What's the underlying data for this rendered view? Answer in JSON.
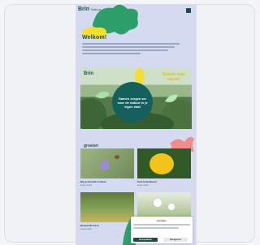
{
  "header": {
    "logo": "Brin",
    "logo_sub": "Natuur"
  },
  "intro": {
    "kicker": "Welkom!"
  },
  "hero": {
    "logo": "Brin",
    "cta": "Samen voor natuur",
    "badge": "Samen zorgen we voor de natuur in je eigen stad"
  },
  "section": {
    "label": "groeien"
  },
  "tiles": [
    {
      "caption": "Bij op Knautia in bloei",
      "sub": "Lees meer"
    },
    {
      "caption": "Gele boterbloem",
      "sub": "Lees meer"
    },
    {
      "caption": "Bloeiende berm",
      "sub": "Lees meer"
    },
    {
      "caption": "Wilde bloemen",
      "sub": "Lees meer"
    }
  ],
  "consent": {
    "title": "Cookies",
    "accept": "Accepteren",
    "decline": "Weigeren"
  },
  "colors": {
    "brand": "#1d4d4a",
    "accent": "#2e9e6a",
    "page": "#d4daf0"
  }
}
